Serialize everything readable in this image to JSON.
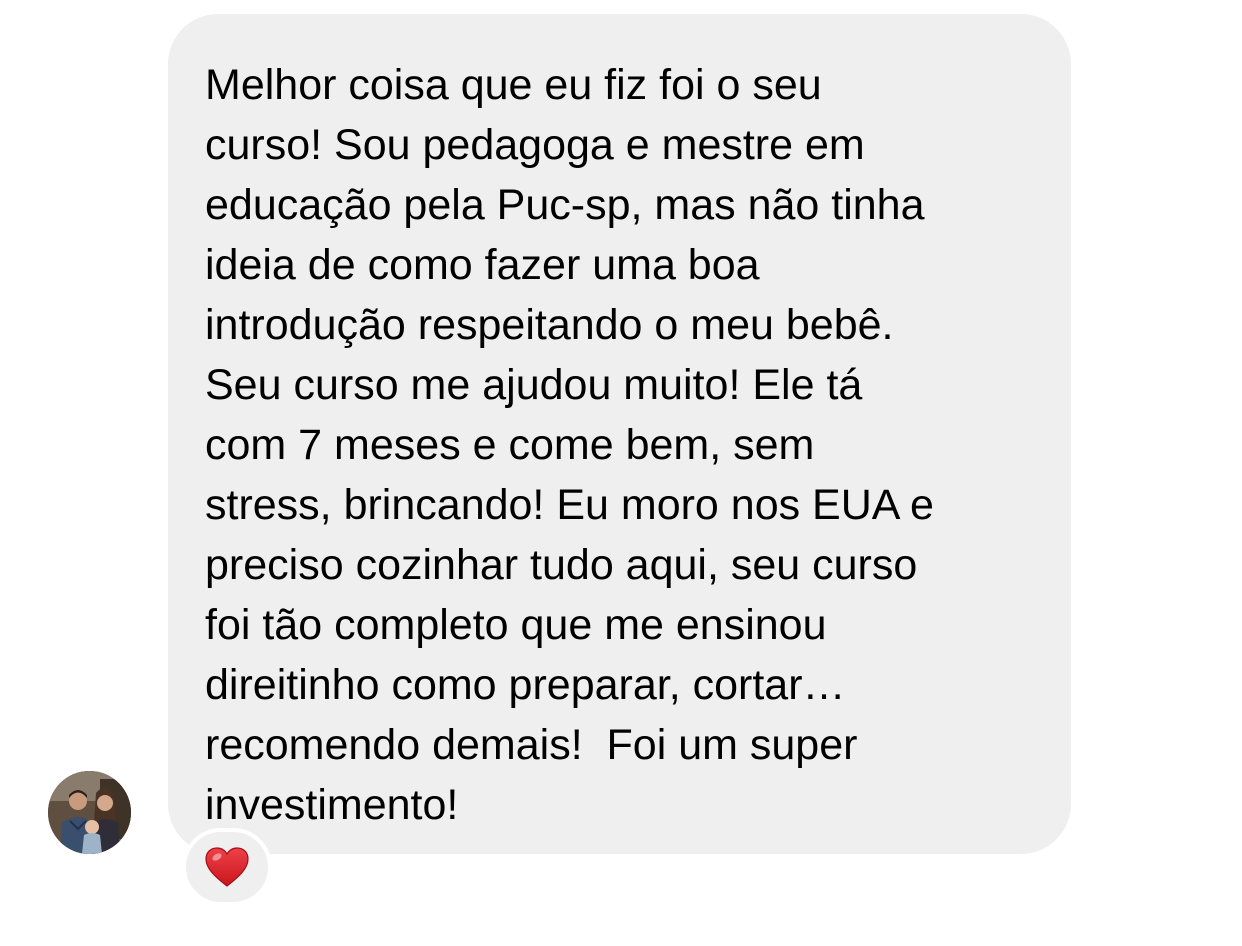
{
  "message": {
    "text": "Melhor coisa que eu fiz foi o seu\ncurso! Sou pedagoga e mestre em\neducação pela Puc-sp, mas não tinha\nideia de como fazer uma boa\nintrodução respeitando o meu bebê.\nSeu curso me ajudou muito! Ele tá\ncom 7 meses e come bem, sem\nstress, brincando! Eu moro nos EUA e\npreciso cozinhar tudo aqui, seu curso\nfoi tão completo que me ensinou\ndireitinho como preparar, cortar…\nrecomendo demais!  Foi um super\ninvestimento!",
    "bubble_color": "#efefef",
    "text_color": "#000000"
  },
  "reaction": {
    "icon": "heart-icon",
    "color": "#e0262c"
  },
  "sender": {
    "avatar_icon": "avatar-photo"
  }
}
